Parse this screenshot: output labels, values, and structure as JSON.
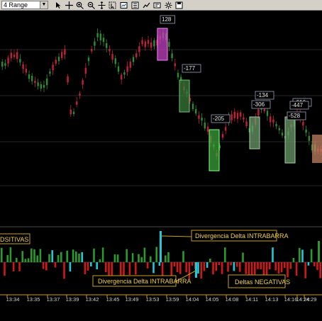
{
  "toolbar": {
    "range_value": "4 Range",
    "icons": [
      "cursor-icon",
      "crosshair-icon",
      "zoom-in-icon",
      "zoom-out-icon",
      "pan-icon",
      "select-icon",
      "chart-properties-icon",
      "indicators-icon",
      "drawing-icon",
      "data-box-icon",
      "settings-icon",
      "save-icon"
    ]
  },
  "colors": {
    "background": "#000000",
    "up_candle": "#2e8b2e",
    "down_candle": "#c0203a",
    "delta_positive": "#2a9a2a",
    "delta_negative": "#d01818",
    "divergence": "#20c8d8",
    "annotation_border": "#c8a020",
    "annotation_text": "#f0d040"
  },
  "box_labels": [
    "128",
    "-177",
    "-205",
    "-134",
    "-306",
    "-616",
    "-447",
    "-528"
  ],
  "annotations": {
    "top_divergence": "Divergencia Delta INTRABARRA",
    "bottom_divergence": "Divergencia Delta INTRABARRA",
    "positive": "DSITIVAS",
    "negative": "Deltas NEGATIVAS"
  },
  "time_axis": [
    "13:34",
    "13:35",
    "13:37",
    "13:39",
    "13:42",
    "13:45",
    "13:49",
    "13:53",
    "13:59",
    "14:04",
    "14:05",
    "14:08",
    "14:11",
    "14:13",
    "14:16",
    "14:24",
    "14:29"
  ]
}
